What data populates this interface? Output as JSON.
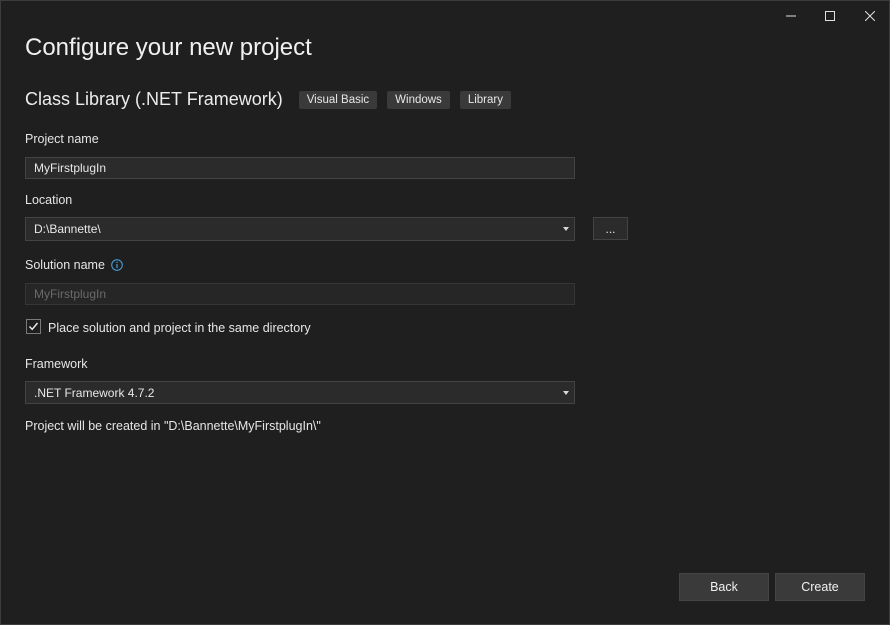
{
  "window": {
    "minimize_icon": "minimize-icon",
    "maximize_icon": "maximize-icon",
    "close_icon": "close-icon"
  },
  "header": {
    "title": "Configure your new project",
    "template_name": "Class Library (.NET Framework)",
    "tags": [
      "Visual Basic",
      "Windows",
      "Library"
    ]
  },
  "form": {
    "project_name_label": "Project name",
    "project_name_value": "MyFirstplugIn",
    "location_label": "Location",
    "location_value": "D:\\Bannette\\",
    "browse_label": "...",
    "solution_name_label": "Solution name",
    "solution_name_value": "MyFirstplugIn",
    "same_directory_label": "Place solution and project in the same directory",
    "same_directory_checked": true,
    "framework_label": "Framework",
    "framework_value": ".NET Framework 4.7.2",
    "created_in_text": "Project will be created in \"D:\\Bannette\\MyFirstplugIn\\\""
  },
  "footer": {
    "back_label": "Back",
    "create_label": "Create"
  },
  "colors": {
    "background": "#1f1f1f",
    "input_bg": "#2b2b2b",
    "button_bg": "#3a3a3a",
    "info_accent": "#4aa3df"
  }
}
